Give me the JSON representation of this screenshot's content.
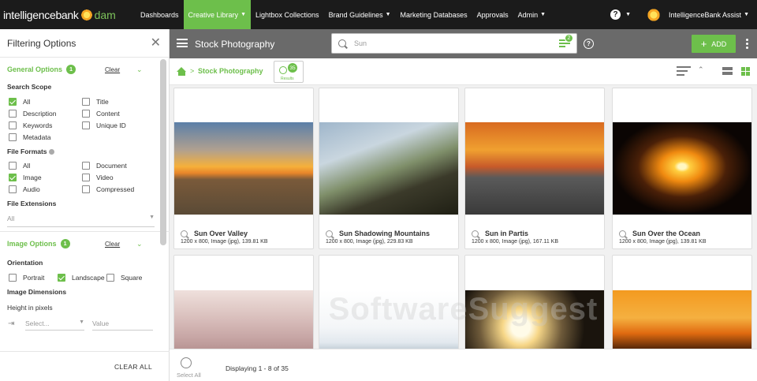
{
  "brand": {
    "word1": "intelligencebank",
    "word2": "dam"
  },
  "nav": {
    "items": [
      {
        "label": "Dashboards",
        "caret": false,
        "active": false
      },
      {
        "label": "Creative Library",
        "caret": true,
        "active": true
      },
      {
        "label": "Lightbox Collections",
        "caret": false,
        "active": false
      },
      {
        "label": "Brand Guidelines",
        "caret": true,
        "active": false
      },
      {
        "label": "Marketing Databases",
        "caret": false,
        "active": false
      },
      {
        "label": "Approvals",
        "caret": false,
        "active": false
      },
      {
        "label": "Admin",
        "caret": true,
        "active": false
      }
    ],
    "help_glyph": "?",
    "user_name": "IntelligenceBank Assist"
  },
  "sidebar": {
    "title": "Filtering Options",
    "general": {
      "title": "General Options",
      "badge": "1",
      "clear": "Clear",
      "scope_label": "Search Scope",
      "scope": [
        {
          "label": "All",
          "checked": true
        },
        {
          "label": "Title",
          "checked": false
        },
        {
          "label": "Description",
          "checked": false
        },
        {
          "label": "Content",
          "checked": false
        },
        {
          "label": "Keywords",
          "checked": false
        },
        {
          "label": "Unique ID",
          "checked": false
        },
        {
          "label": "Metadata",
          "checked": false
        }
      ],
      "formats_label": "File Formats",
      "formats": [
        {
          "label": "All",
          "checked": false
        },
        {
          "label": "Document",
          "checked": false
        },
        {
          "label": "Image",
          "checked": true
        },
        {
          "label": "Video",
          "checked": false
        },
        {
          "label": "Audio",
          "checked": false
        },
        {
          "label": "Compressed",
          "checked": false
        }
      ],
      "extensions_label": "File Extensions",
      "extensions_value": "All"
    },
    "image": {
      "title": "Image Options",
      "badge": "1",
      "clear": "Clear",
      "orientation_label": "Orientation",
      "orientation": [
        {
          "label": "Portrait",
          "checked": false
        },
        {
          "label": "Landscape",
          "checked": true
        },
        {
          "label": "Square",
          "checked": false
        }
      ],
      "dimensions_label": "Image Dimensions",
      "height_label": "Height in pixels",
      "select_placeholder": "Select...",
      "value_placeholder": "Value"
    },
    "clear_all": "CLEAR ALL"
  },
  "toolbar": {
    "title": "Stock Photography",
    "search_value": "Sun",
    "filter_count": "2",
    "add_label": "ADD"
  },
  "breadcrumb": {
    "current": "Stock Photography",
    "sep": ">",
    "results_count": "35",
    "results_label": "Results"
  },
  "assets": [
    {
      "title": "Sun Over Valley",
      "meta": "1200 x 800, Image (jpg), 139.81 KB"
    },
    {
      "title": "Sun Shadowing Mountains",
      "meta": "1200 x 800, Image (jpg), 229.83 KB"
    },
    {
      "title": "Sun in Partis",
      "meta": "1200 x 800, Image (jpg), 167.11 KB"
    },
    {
      "title": "Sun Over the Ocean",
      "meta": "1200 x 800, Image (jpg), 139.81 KB"
    },
    {
      "title": "",
      "meta": ""
    },
    {
      "title": "",
      "meta": ""
    },
    {
      "title": "",
      "meta": ""
    },
    {
      "title": "",
      "meta": ""
    }
  ],
  "watermark": "SoftwareSuggest",
  "footer": {
    "select_all": "Select All",
    "displaying": "Displaying 1 - 8  of 35"
  }
}
